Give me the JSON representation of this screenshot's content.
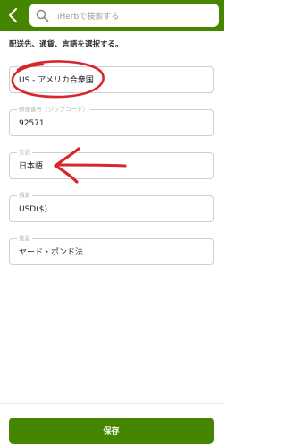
{
  "header": {
    "search_placeholder": "iHerbで検索する"
  },
  "intro_text": "配送先、通貨、言語を選択する。",
  "fields": {
    "country": {
      "value": "US - アメリカ合衆国"
    },
    "zip": {
      "label": "郵便番号（ジップコード）",
      "value": "92571"
    },
    "language": {
      "label": "言語",
      "value": "日本語"
    },
    "currency": {
      "label": "通貨",
      "value": "USD($)"
    },
    "weight": {
      "label": "重量",
      "value": "ヤード・ポンド法"
    }
  },
  "save_label": "保存",
  "colors": {
    "brand_green": "#458500",
    "annotation_red": "#d8262b"
  }
}
